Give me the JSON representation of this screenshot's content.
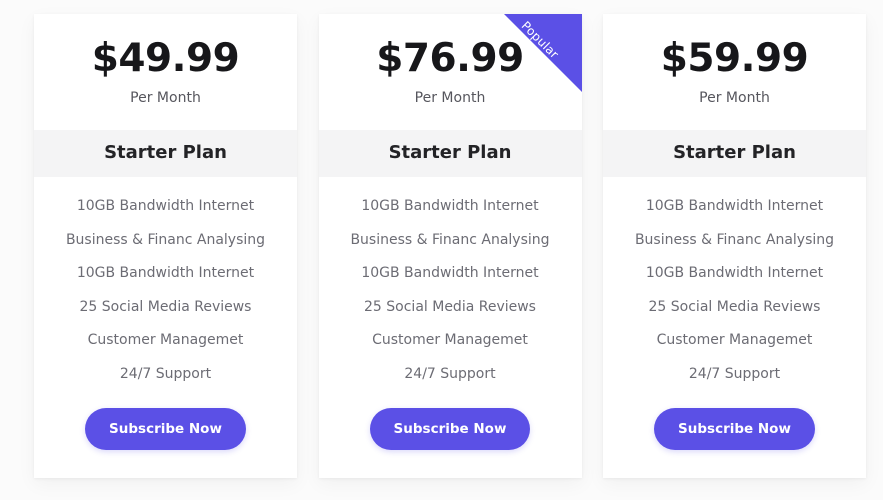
{
  "page": {
    "background_color": "#fbfbfb",
    "accent_color": "#5b50e6",
    "band_color": "#f4f4f5"
  },
  "plans": [
    {
      "price": "$49.99",
      "period": "Per Month",
      "name": "Starter Plan",
      "popular": false,
      "ribbon_label": "",
      "cta_label": "Subscribe Now",
      "features": [
        "10GB Bandwidth Internet",
        "Business & Financ Analysing",
        "10GB Bandwidth Internet",
        "25 Social Media Reviews",
        "Customer Managemet",
        "24/7 Support"
      ]
    },
    {
      "price": "$76.99",
      "period": "Per Month",
      "name": "Starter Plan",
      "popular": true,
      "ribbon_label": "Popular",
      "cta_label": "Subscribe Now",
      "features": [
        "10GB Bandwidth Internet",
        "Business & Financ Analysing",
        "10GB Bandwidth Internet",
        "25 Social Media Reviews",
        "Customer Managemet",
        "24/7 Support"
      ]
    },
    {
      "price": "$59.99",
      "period": "Per Month",
      "name": "Starter Plan",
      "popular": false,
      "ribbon_label": "",
      "cta_label": "Subscribe Now",
      "features": [
        "10GB Bandwidth Internet",
        "Business & Financ Analysing",
        "10GB Bandwidth Internet",
        "25 Social Media Reviews",
        "Customer Managemet",
        "24/7 Support"
      ]
    }
  ]
}
